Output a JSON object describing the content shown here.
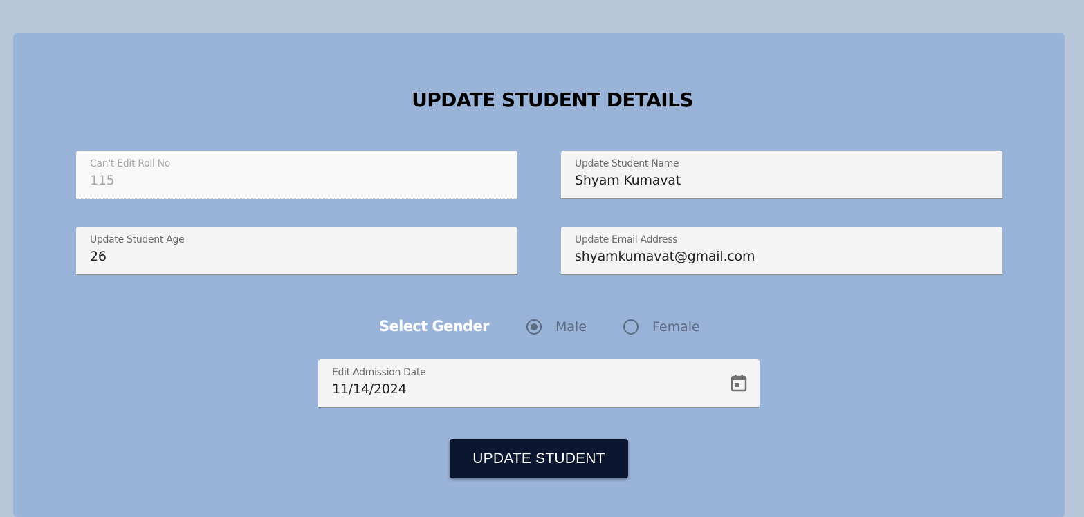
{
  "page": {
    "title": "UPDATE STUDENT DETAILS"
  },
  "form": {
    "roll_no": {
      "label": "Can't Edit Roll No",
      "value": "115"
    },
    "name": {
      "label": "Update Student Name",
      "value": "Shyam Kumavat"
    },
    "age": {
      "label": "Update Student Age",
      "value": "26"
    },
    "email": {
      "label": "Update Email Address",
      "value": "shyamkumavat@gmail.com"
    },
    "gender": {
      "label": "Select Gender",
      "options": [
        {
          "label": "Male",
          "selected": true
        },
        {
          "label": "Female",
          "selected": false
        }
      ]
    },
    "admission_date": {
      "label": "Edit Admission Date",
      "value": "11/14/2024",
      "icon": "calendar-icon"
    },
    "submit_label": "UPDATE STUDENT"
  },
  "colors": {
    "page_bg": "#b8c6da",
    "card_bg": "#9ab3d8",
    "button_bg": "#0b1630",
    "radio": "#5d6b82"
  }
}
